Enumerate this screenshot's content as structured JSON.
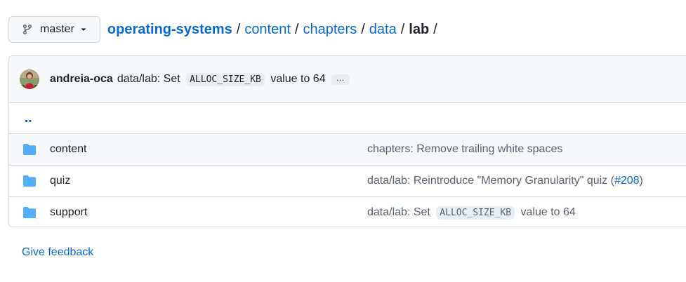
{
  "branch": {
    "name": "master",
    "icon": "git-branch-icon"
  },
  "breadcrumb": {
    "root": "operating-systems",
    "parts": [
      "content",
      "chapters",
      "data"
    ],
    "current": "lab",
    "separator": "/"
  },
  "latest_commit": {
    "author": "andreia-oca",
    "message_prefix": "data/lab: Set",
    "message_code": "ALLOC_SIZE_KB",
    "message_suffix": "value to 64",
    "more": "…"
  },
  "parent_dir": "‥",
  "rows": [
    {
      "name": "content",
      "commit_text": "chapters: Remove trailing white spaces"
    },
    {
      "name": "quiz",
      "commit_prefix": "data/lab: Reintroduce \"Memory Granularity\" quiz (",
      "commit_link": "#208",
      "commit_suffix": ")"
    },
    {
      "name": "support",
      "commit_prefix": "data/lab: Set",
      "commit_code": "ALLOC_SIZE_KB",
      "commit_suffix": "value to 64"
    }
  ],
  "feedback": "Give feedback",
  "colors": {
    "link": "#0969da",
    "folder": "#54aeff",
    "muted": "#59636e",
    "border": "#d0d7de",
    "header_bg": "#f6f8fa"
  }
}
